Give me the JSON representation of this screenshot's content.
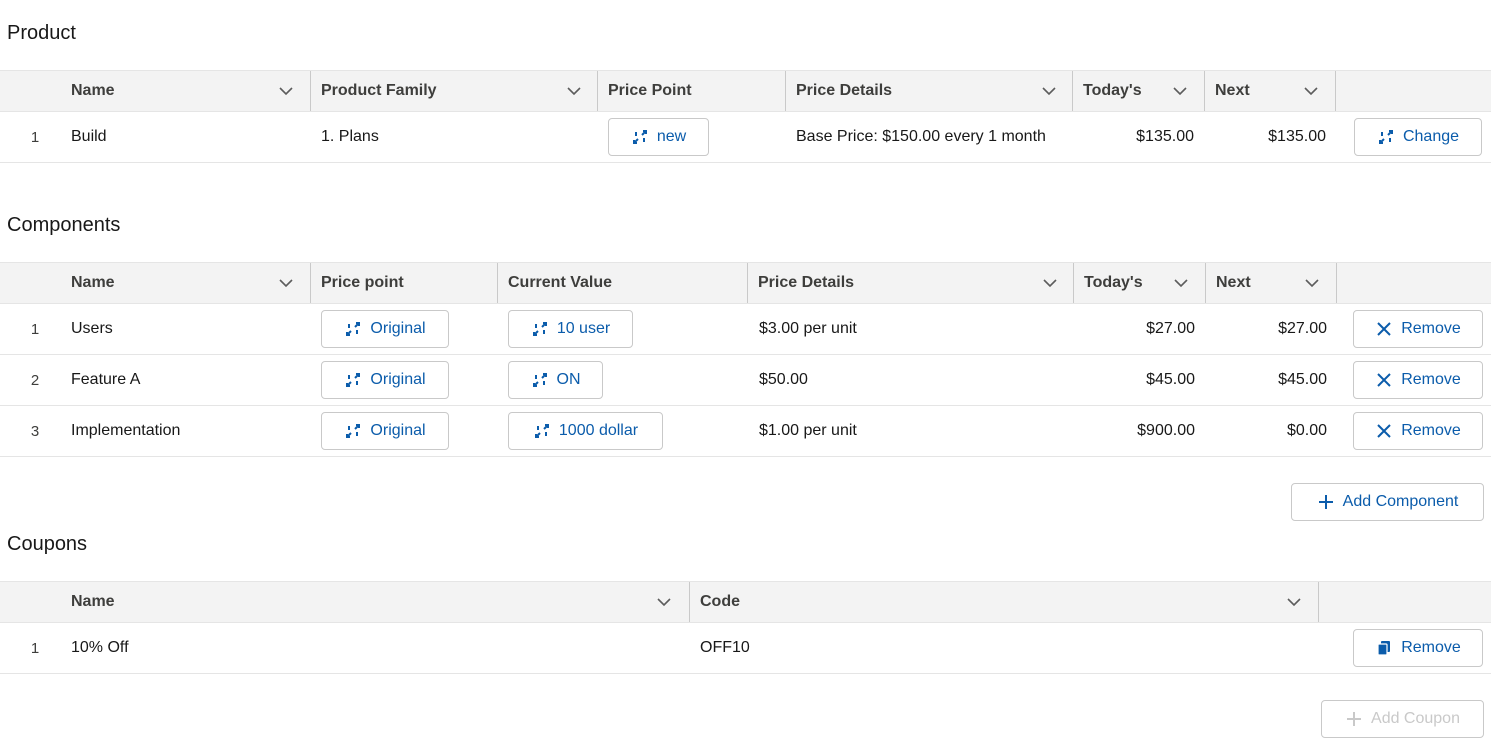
{
  "product": {
    "title": "Product",
    "columns": [
      "Name",
      "Product Family",
      "Price Point",
      "Price Details",
      "Today's",
      "Next"
    ],
    "rows": [
      {
        "num": "1",
        "name": "Build",
        "family": "1. Plans",
        "price_point": "new",
        "details": "Base Price: $150.00 every 1 month",
        "today": "$135.00",
        "next": "$135.00",
        "action": "Change"
      }
    ]
  },
  "components": {
    "title": "Components",
    "columns": [
      "Name",
      "Price point",
      "Current Value",
      "Price Details",
      "Today's",
      "Next"
    ],
    "rows": [
      {
        "num": "1",
        "name": "Users",
        "price_point": "Original",
        "current": "10 user",
        "details": "$3.00 per unit",
        "today": "$27.00",
        "next": "$27.00",
        "action": "Remove"
      },
      {
        "num": "2",
        "name": "Feature A",
        "price_point": "Original",
        "current": "ON",
        "details": "$50.00",
        "today": "$45.00",
        "next": "$45.00",
        "action": "Remove"
      },
      {
        "num": "3",
        "name": "Implementation",
        "price_point": "Original",
        "current": "1000 dollar",
        "details": "$1.00 per unit",
        "today": "$900.00",
        "next": "$0.00",
        "action": "Remove"
      }
    ],
    "add_label": "Add Component"
  },
  "coupons": {
    "title": "Coupons",
    "columns": [
      "Name",
      "Code"
    ],
    "rows": [
      {
        "num": "1",
        "name": "10% Off",
        "code": "OFF10",
        "action": "Remove"
      }
    ],
    "add_label": "Add Coupon"
  },
  "colors": {
    "accent": "#0b5cab",
    "header_bg": "#f3f3f3",
    "border": "#c9c9c9"
  },
  "icons": {
    "swap": "swap-icon",
    "chevron": "chevron-down-icon",
    "close": "close-icon",
    "copy": "copy-icon",
    "add": "add-icon"
  }
}
